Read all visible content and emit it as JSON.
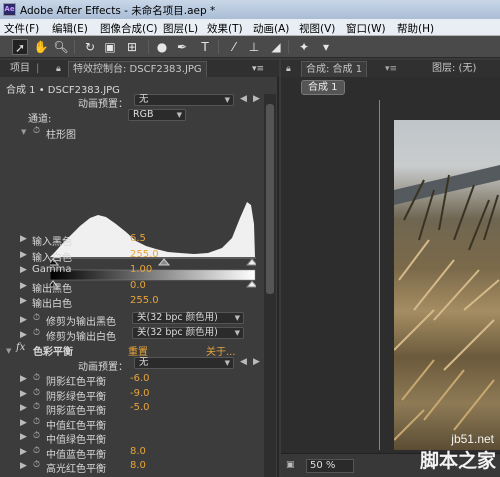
{
  "window": {
    "title": "Adobe After Effects - 未命名项目.aep *",
    "app_badge": "Ae"
  },
  "menu": [
    "文件(F)",
    "编辑(E)",
    "图像合成(C)",
    "图层(L)",
    "效果(T)",
    "动画(A)",
    "视图(V)",
    "窗口(W)",
    "帮助(H)"
  ],
  "left_tabs": {
    "project": "项目",
    "effects": "特效控制台: DSCF2383.JPG",
    "menu_glyph": "▾≡"
  },
  "effect_header": "合成 1 • DSCF2383.JPG",
  "levels": {
    "preset_label": "动画预置：",
    "preset_value": "无",
    "channel_label": "通道:",
    "channel_value": "RGB",
    "histogram_label": "柱形图",
    "props": [
      {
        "label": "输入黑色",
        "value": "6.5"
      },
      {
        "label": "输入白色",
        "value": "255.0"
      },
      {
        "label": "Gamma",
        "value": "1.00"
      },
      {
        "label": "输出黑色",
        "value": "0.0"
      },
      {
        "label": "输出白色",
        "value": "255.0"
      }
    ],
    "clip_black_label": "修剪为输出黑色",
    "clip_black_value": "关(32 bpc 颜色用)",
    "clip_white_label": "修剪为输出白色",
    "clip_white_value": "关(32 bpc 颜色用)"
  },
  "color_balance": {
    "fx": "fx",
    "name": "色彩平衡",
    "reset": "重置",
    "about": "关于...",
    "preset_label": "动画预置：",
    "preset_value": "无",
    "props": [
      {
        "label": "阴影红色平衡",
        "value": "-6.0"
      },
      {
        "label": "阴影绿色平衡",
        "value": "-9.0"
      },
      {
        "label": "阴影蓝色平衡",
        "value": "-5.0"
      },
      {
        "label": "中值红色平衡",
        "value": ""
      },
      {
        "label": "中值绿色平衡",
        "value": ""
      },
      {
        "label": "中值蓝色平衡",
        "value": "8.0"
      },
      {
        "label": "高光红色平衡",
        "value": "8.0"
      }
    ]
  },
  "right_tabs": {
    "comp": "合成: 合成 1",
    "layer": "图层: (无)"
  },
  "comp_button": "合成 1",
  "zoom": "50 %",
  "watermark": {
    "site": "jb51.net",
    "name": "脚本之家"
  }
}
